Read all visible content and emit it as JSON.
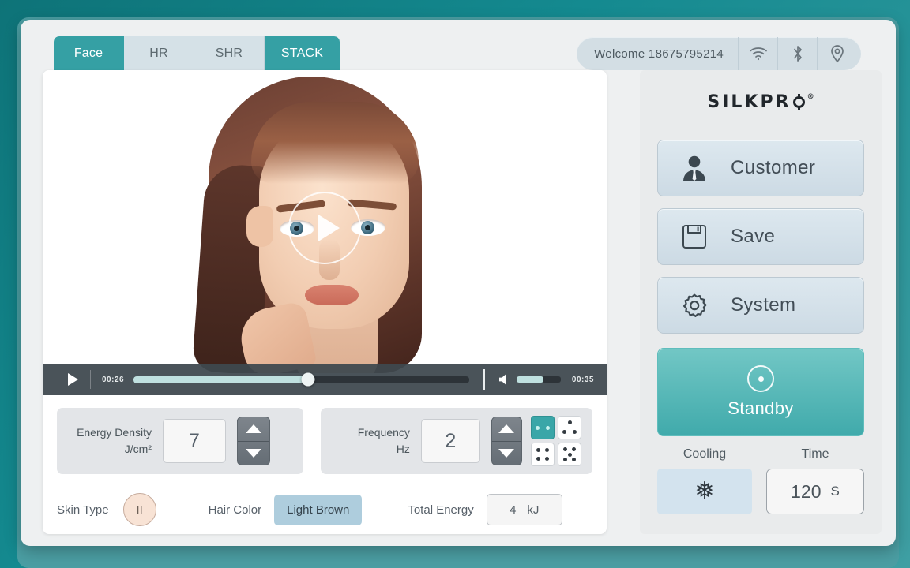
{
  "window": {
    "tabs": [
      {
        "label": "Face",
        "active": true
      },
      {
        "label": "HR",
        "active": false
      },
      {
        "label": "SHR",
        "active": false
      },
      {
        "label": "STACK",
        "active": true
      }
    ],
    "welcome": "Welcome 18675795214",
    "status_icons": [
      "wifi-icon",
      "bluetooth-icon",
      "location-icon"
    ]
  },
  "video": {
    "play_overlay": "play-icon",
    "current_time": "00:26",
    "total_time": "00:35",
    "progress_percent": 52,
    "volume_percent": 60
  },
  "parameters": {
    "energy": {
      "label_line1": "Energy Density",
      "label_line2": "J/cm²",
      "value": "7"
    },
    "frequency": {
      "label_line1": "Frequency",
      "label_line2": "Hz",
      "value": "2",
      "modes": [
        {
          "name": "dice-2",
          "dots": 2,
          "selected": true
        },
        {
          "name": "dice-3",
          "dots": 3,
          "selected": false
        },
        {
          "name": "dice-4",
          "dots": 4,
          "selected": false
        },
        {
          "name": "dice-5",
          "dots": 5,
          "selected": false
        }
      ]
    }
  },
  "bottom": {
    "skin_type_label": "Skin Type",
    "skin_type_value": "II",
    "hair_color_label": "Hair Color",
    "hair_color_value": "Light Brown",
    "total_energy_label": "Total Energy",
    "total_energy_value": "4",
    "total_energy_unit": "kJ"
  },
  "sidebar": {
    "brand": "SILKPR",
    "brand_registered": "®",
    "buttons": [
      {
        "label": "Customer",
        "icon": "user-icon"
      },
      {
        "label": "Save",
        "icon": "floppy-disk-icon"
      },
      {
        "label": "System",
        "icon": "gear-icon"
      }
    ],
    "standby_label": "Standby",
    "standby_icon": "power-icon",
    "cooling_label": "Cooling",
    "cooling_icon": "snowflake-icon",
    "cooling_glyph": "❅",
    "time_label": "Time",
    "time_value": "120",
    "time_unit": "S"
  },
  "colors": {
    "accent_teal": "#35a0a4",
    "frame_teal": "#137f85",
    "tab_inactive": "#d5e1e7",
    "panel_gray": "#e9ebec",
    "hair_chip": "#aecddd",
    "skin_circle": "#f8e3d5"
  }
}
